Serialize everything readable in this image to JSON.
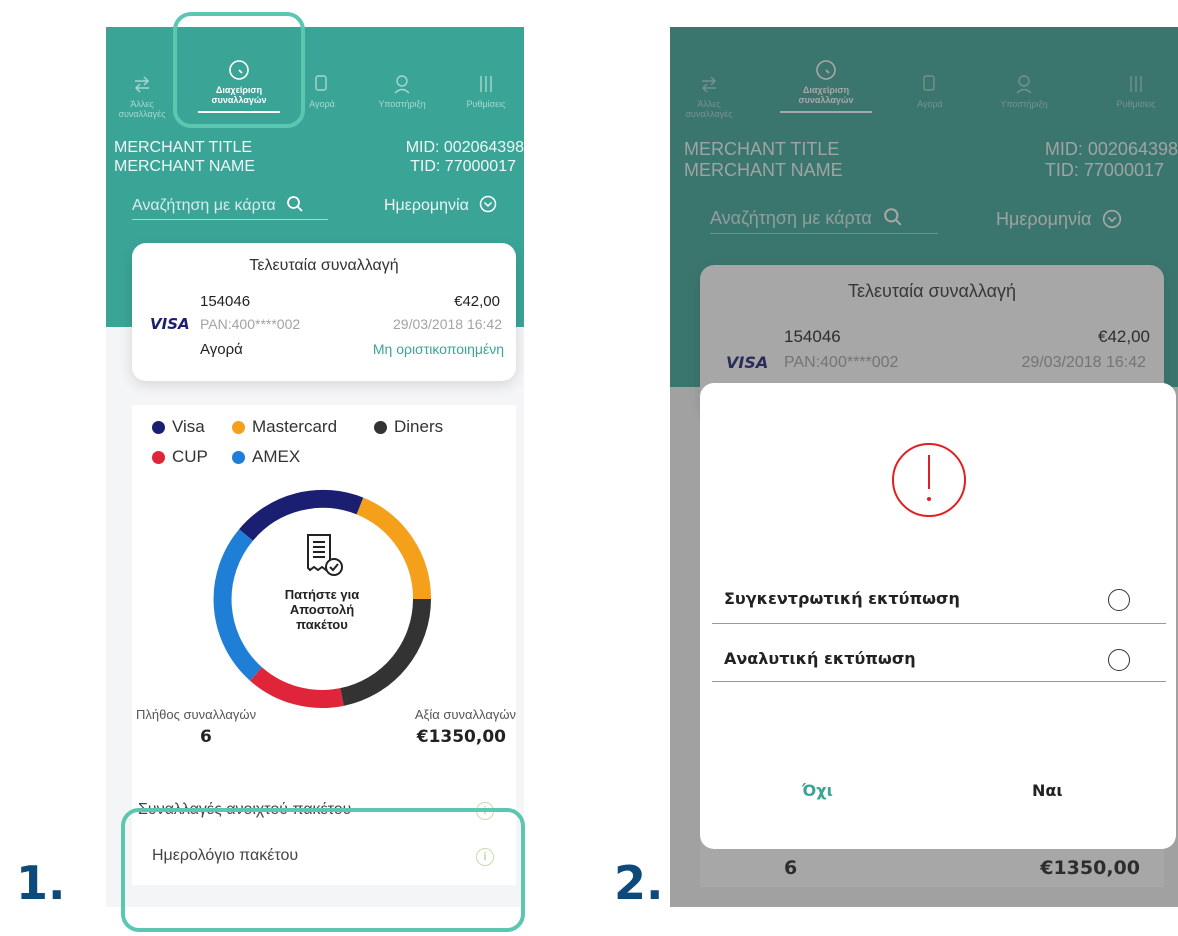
{
  "steps": {
    "first": "1.",
    "second": "2."
  },
  "colors": {
    "teal": "#3aa597",
    "highlight": "#5bc7b0",
    "visa": "#1a1f71",
    "mastercard": "#f5a01a",
    "diners": "#333333",
    "cup": "#e0243a",
    "amex": "#1f7fd6",
    "alert": "#e02020"
  },
  "nav": {
    "items": [
      {
        "label": "Άλλες συναλλαγές",
        "icon": "transfer-icon"
      },
      {
        "label": "Διαχείριση συναλλαγών",
        "icon": "clock-icon",
        "active": true
      },
      {
        "label": "Αγορά",
        "icon": "hand-card-icon"
      },
      {
        "label": "Υποστήριξη",
        "icon": "support-agent-icon"
      },
      {
        "label": "Ρυθμίσεις",
        "icon": "sliders-icon"
      }
    ]
  },
  "merchant": {
    "title": "MERCHANT TITLE",
    "name": "MERCHANT NAME",
    "mid": "MID: 002064398",
    "tid": "TID: 77000017"
  },
  "search": {
    "card_label": "Αναζήτηση με κάρτα",
    "date_label": "Ημερομηνία"
  },
  "last_transaction": {
    "title": "Τελευταία συναλλαγή",
    "id": "154046",
    "amount": "€42,00",
    "card_brand": "VISA",
    "pan": "PAN:400****002",
    "datetime": "29/03/2018 16:42",
    "type": "Αγορά",
    "status": "Μη οριστικοποιημένη"
  },
  "legend": [
    "Visa",
    "Mastercard",
    "Diners",
    "CUP",
    "AMEX"
  ],
  "donut": {
    "center_line1": "Πατήστε για",
    "center_line2": "Αποστολή",
    "center_line3": "πακέτου"
  },
  "stats": {
    "count_label": "Πλήθος συναλλαγών",
    "count_value": "6",
    "value_label": "Αξία συναλλαγών",
    "value_amount": "€1350,00"
  },
  "rows": {
    "open_batch": "Συναλλαγές ανοιχτού πακέτου",
    "batch_log": "Ημερολόγιο πακέτου"
  },
  "dialog": {
    "option1": "Συγκεντρωτική εκτύπωση",
    "option2": "Αναλυτική εκτύπωση",
    "no": "Όχι",
    "yes": "Ναι"
  }
}
